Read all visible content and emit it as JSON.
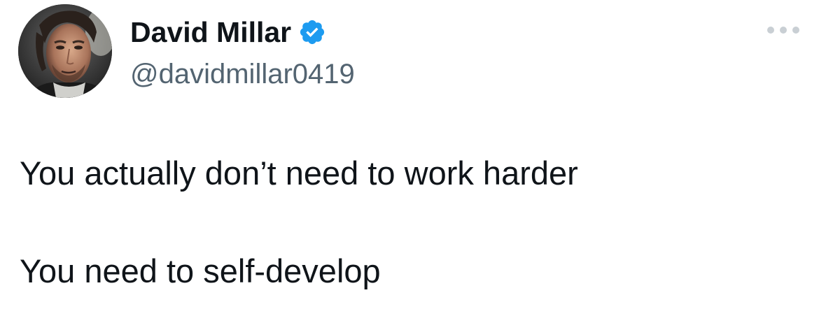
{
  "author": {
    "display_name": "David Millar",
    "handle": "@davidmillar0419",
    "verified": true,
    "avatar_icon": "profile-photo"
  },
  "actions": {
    "more_icon": "more-horizontal-icon"
  },
  "tweet": {
    "lines": [
      "You actually don’t need to work harder",
      "You need to self-develop"
    ]
  },
  "colors": {
    "text_primary": "#0f1419",
    "text_secondary": "#536471",
    "verified_blue": "#1d9bf0",
    "more_dots": "#c9cfd4"
  }
}
